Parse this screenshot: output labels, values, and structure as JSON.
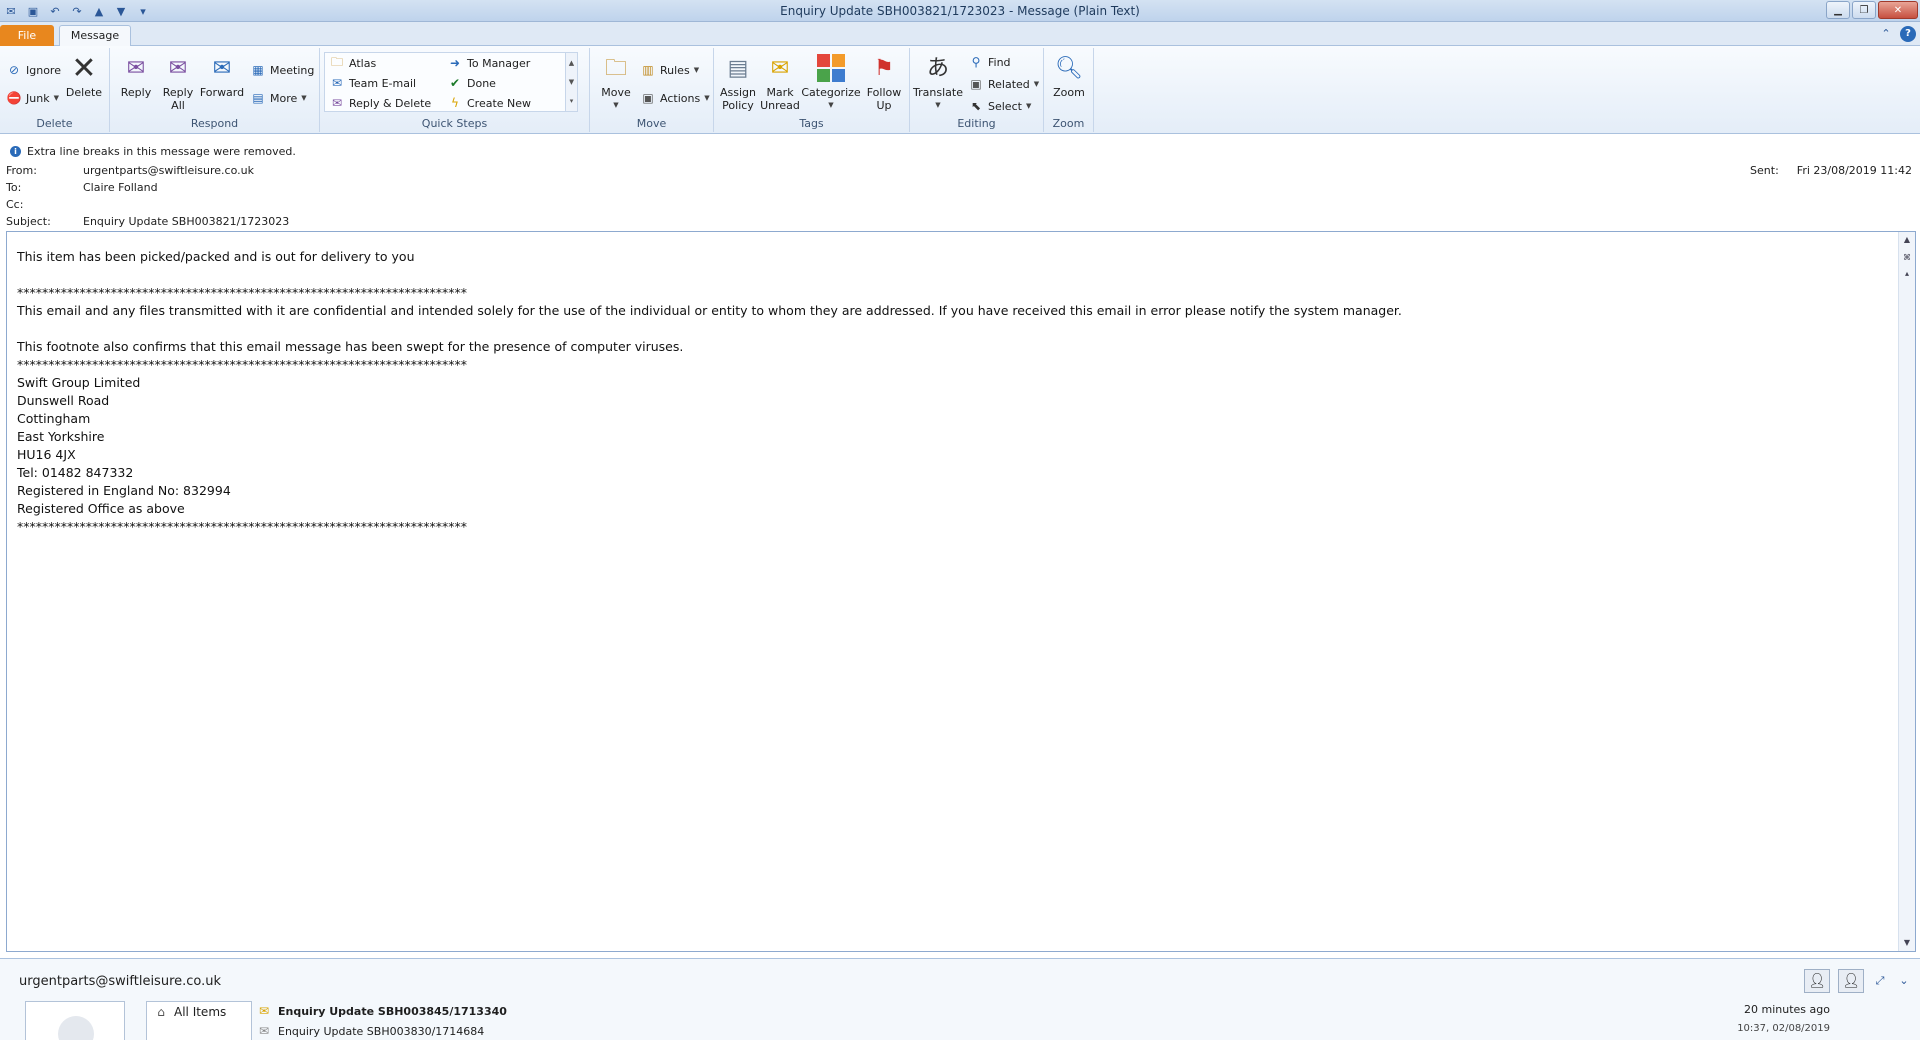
{
  "window": {
    "title": "Enquiry Update SBH003821/1723023  -  Message (Plain Text)"
  },
  "tabs": {
    "file": "File",
    "message": "Message"
  },
  "ribbon": {
    "delete": {
      "label": "Delete",
      "ignore": "Ignore",
      "junk": "Junk",
      "delete_btn": "Delete"
    },
    "respond": {
      "label": "Respond",
      "reply": "Reply",
      "reply_all_1": "Reply",
      "reply_all_2": "All",
      "forward": "Forward",
      "meeting": "Meeting",
      "more": "More"
    },
    "quick_steps": {
      "label": "Quick Steps",
      "items": [
        "Atlas",
        "To Manager",
        "Team E-mail",
        "Done",
        "Reply & Delete",
        "Create New"
      ]
    },
    "move": {
      "label": "Move",
      "move_btn": "Move",
      "rules": "Rules",
      "actions": "Actions"
    },
    "tags": {
      "label": "Tags",
      "assign_1": "Assign",
      "assign_2": "Policy",
      "mark_1": "Mark",
      "mark_2": "Unread",
      "categorize": "Categorize",
      "follow_1": "Follow",
      "follow_2": "Up"
    },
    "editing": {
      "label": "Editing",
      "translate": "Translate",
      "find": "Find",
      "related": "Related",
      "select": "Select"
    },
    "zoom": {
      "label": "Zoom",
      "zoom_btn": "Zoom"
    }
  },
  "infobar": "Extra line breaks in this message were removed.",
  "header": {
    "from_label": "From:",
    "from": "urgentparts@swiftleisure.co.uk",
    "to_label": "To:",
    "to": "Claire Folland",
    "cc_label": "Cc:",
    "cc": "",
    "subject_label": "Subject:",
    "subject": "Enquiry Update SBH003821/1723023",
    "sent_label": "Sent:",
    "sent": "Fri 23/08/2019 11:42"
  },
  "body_lines": [
    "This item has been picked/packed and is out for delivery to you",
    "",
    "************************************************************************",
    "This email and any files transmitted with it are confidential and intended solely for the use of the individual or entity to whom they are addressed. If you have received this email in error please notify the system manager.",
    "",
    "This footnote also confirms that this email message has been swept for the presence of computer viruses.",
    "************************************************************************",
    "Swift Group Limited",
    "Dunswell Road",
    "Cottingham",
    "East Yorkshire",
    "HU16 4JX",
    "Tel: 01482 847332",
    "Registered in England No: 832994",
    "Registered Office as above",
    "************************************************************************"
  ],
  "people_pane": {
    "email": "urgentparts@swiftleisure.co.uk",
    "side_item": "All Items",
    "items": [
      {
        "subject": "Enquiry Update SBH003845/1713340",
        "time": "20 minutes ago"
      },
      {
        "subject": "Enquiry Update SBH003830/1714684",
        "time": "10:37, 02/08/2019"
      }
    ]
  },
  "colors": {
    "file_tab": "#e8871e",
    "accent": "#2a6ab8",
    "ribbon_bg": "#e4edf8"
  }
}
